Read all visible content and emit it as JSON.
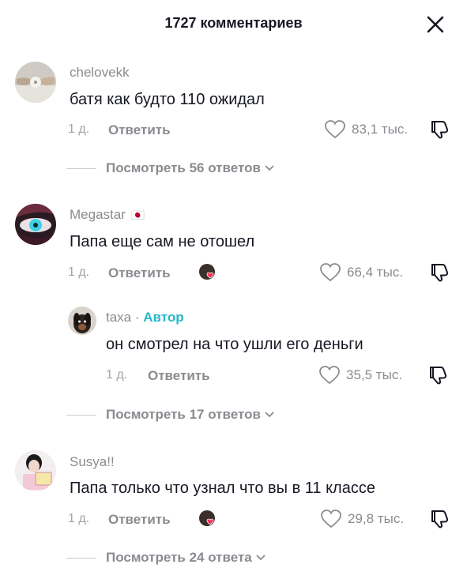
{
  "header": {
    "title": "1727 комментариев"
  },
  "comments": [
    {
      "username": "chelovekk",
      "text": "батя как будто 110 ожидал",
      "time": "1 д.",
      "reply_label": "Ответить",
      "likes": "83,1 тыс.",
      "view_replies": "Посмотреть 56 ответов"
    },
    {
      "username": "Megastar",
      "flag": "🇯🇵",
      "text": "Папа еще сам не отошел",
      "time": "1 д.",
      "reply_label": "Ответить",
      "likes": "66,4 тыс.",
      "reply": {
        "username": "taxa",
        "separator": "·",
        "author_label": "Автор",
        "text": "он смотрел на что ушли его деньги",
        "time": "1 д.",
        "reply_label": "Ответить",
        "likes": "35,5 тыс."
      },
      "view_replies": "Посмотреть 17 ответов"
    },
    {
      "username": "Susya!!",
      "text": "Папа только что узнал что вы в 11 классе",
      "time": "1 д.",
      "reply_label": "Ответить",
      "likes": "29,8 тыс.",
      "view_replies": "Посмотреть 24 ответа"
    }
  ],
  "colors": {
    "text": "#161823",
    "muted": "#8a8b91",
    "author_accent": "#25b9c9",
    "creator_heart": "#fe2c55"
  },
  "icons": [
    "close-icon",
    "heart-icon",
    "dislike-icon",
    "chevron-down-icon",
    "creator-liked-heart-icon"
  ]
}
